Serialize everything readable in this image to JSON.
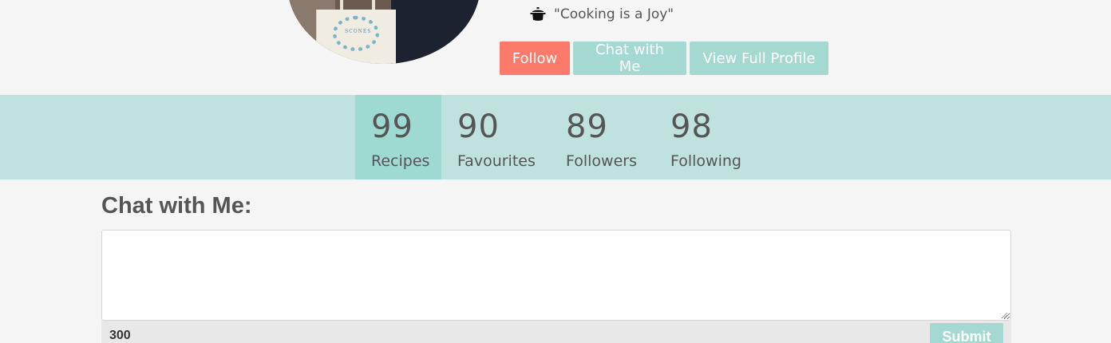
{
  "profile": {
    "quote": "\"Cooking is a Joy\"",
    "quote_icon": "cooking-pot-icon",
    "avatar_bag_text": "SCONES"
  },
  "actions": {
    "follow_label": "Follow",
    "chat_label": "Chat with Me",
    "view_profile_label": "View Full Profile"
  },
  "stats": [
    {
      "value": "99",
      "label": "Recipes"
    },
    {
      "value": "90",
      "label": "Favourites"
    },
    {
      "value": "89",
      "label": "Followers"
    },
    {
      "value": "98",
      "label": "Following"
    }
  ],
  "chat": {
    "heading": "Chat with Me:",
    "message_value": "",
    "char_count": "300",
    "submit_label": "Submit"
  },
  "colors": {
    "follow_button": "#fb7a6a",
    "accent_teal": "#a3d9d1",
    "stats_bar": "#bfe2de",
    "stats_active": "#9fdad2",
    "background": "#f5f5f5"
  }
}
